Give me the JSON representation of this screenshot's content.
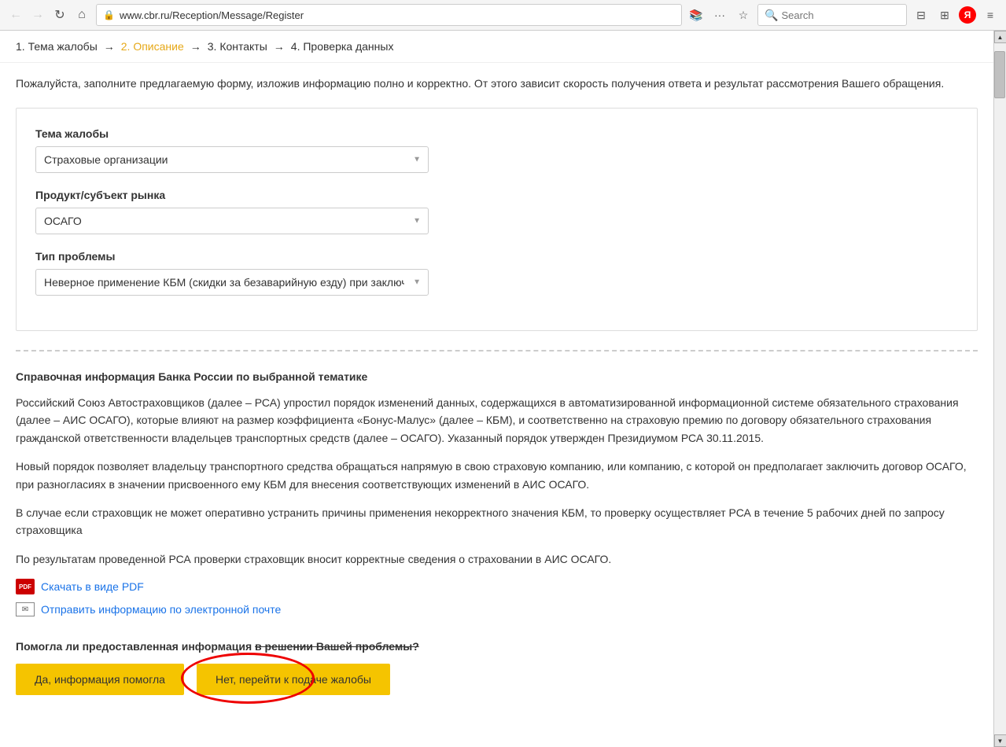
{
  "browser": {
    "back_label": "←",
    "forward_label": "→",
    "refresh_label": "↻",
    "home_label": "⌂",
    "url": "www.cbr.ru/Reception/Message/Register",
    "menu_label": "···",
    "bookmark_label": "☆",
    "search_placeholder": "Search",
    "hamburger_label": "≡",
    "yandex_label": "Я"
  },
  "steps": {
    "step1": "1. Тема жалобы",
    "arrow1": "→",
    "step2": "2. Описание",
    "arrow2": "→",
    "step3": "3. Контакты",
    "arrow3": "→",
    "step4": "4. Проверка данных"
  },
  "intro": {
    "text": "Пожалуйста, заполните предлагаемую форму, изложив информацию полно и корректно. От этого зависит скорость получения ответа и результат рассмотрения Вашего обращения."
  },
  "form": {
    "field1_label": "Тема жалобы",
    "field1_value": "Страховые организации",
    "field2_label": "Продукт/субъект рынка",
    "field2_value": "ОСАГО",
    "field3_label": "Тип проблемы",
    "field3_value": "Неверное применение КБМ (скидки за безаварийную езду) при заключении договора"
  },
  "info": {
    "title": "Справочная информация Банка России по выбранной тематике",
    "paragraph1": "Российский Союз Автостраховщиков (далее – РСА) упростил порядок изменений данных, содержащихся в автоматизированной информационной системе обязательного страхования (далее – АИС ОСАГО), которые влияют на размер коэффициента «Бонус-Малус» (далее – КБМ), и соответственно на страховую премию по договору обязательного страхования гражданской ответственности владельцев транспортных средств (далее – ОСАГО). Указанный порядок утвержден Президиумом РСА 30.11.2015.",
    "paragraph2": "Новый порядок позволяет владельцу транспортного средства обращаться напрямую в свою страховую компанию, или компанию, с которой он предполагает заключить договор ОСАГО, при разногласиях в значении присвоенного ему КБМ для внесения соответствующих изменений в АИС ОСАГО.",
    "paragraph3": "В случае если страховщик не может оперативно устранить причины применения некорректного значения КБМ, то проверку осуществляет РСА в течение 5 рабочих дней по запросу страховщика",
    "paragraph4": "По результатам проведенной РСА проверки страховщик вносит корректные сведения о страховании в АИС ОСАГО.",
    "pdf_icon": "PDF",
    "pdf_link": "Скачать в виде PDF",
    "email_icon": "✉",
    "email_link": "Отправить информацию по электронной почте"
  },
  "question": {
    "text_part1": "Помогла ли предоставленная информация",
    "text_strikethrough": "в решении Вашей проблемы?",
    "btn_yes": "Да, информация помогла",
    "btn_no": "Нет, перейти к подаче жалобы"
  }
}
